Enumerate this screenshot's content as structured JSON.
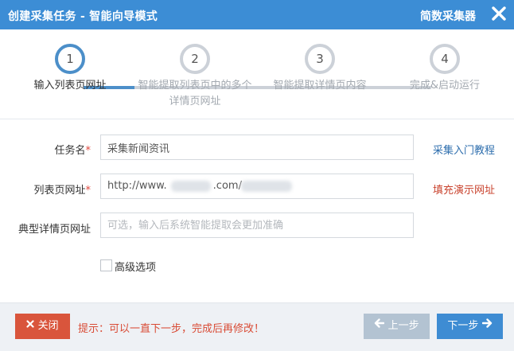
{
  "window": {
    "title": "创建采集任务 - 智能向导模式",
    "brand": "简数采集器",
    "close_icon": "close-icon"
  },
  "steps": [
    {
      "number": "1",
      "label": "输入列表页网址",
      "active": true
    },
    {
      "number": "2",
      "label_line1": "智能提取列表页中的多个",
      "label_line2": "详情页网址",
      "active": false
    },
    {
      "number": "3",
      "label": "智能提取详情页内容",
      "active": false
    },
    {
      "number": "4",
      "label": "完成&启动运行",
      "active": false
    }
  ],
  "form": {
    "task_name": {
      "label": "任务名",
      "required_mark": "*",
      "value": "采集新闻资讯",
      "side_link": "采集入门教程"
    },
    "list_url": {
      "label": "列表页网址",
      "required_mark": "*",
      "value_prefix": "http://www.",
      "value_mid": ".com/",
      "side_link": "填充演示网址"
    },
    "detail_url": {
      "label": "典型详情页网址",
      "placeholder": "可选，输入后系统智能提取会更加准确"
    },
    "advanced": {
      "label": "高级选项",
      "checked": false
    }
  },
  "footer": {
    "close_label": "关闭",
    "tip": "提示：可以一直下一步，完成后再修改！",
    "prev_label": "上一步",
    "next_label": "下一步"
  },
  "colors": {
    "title_bar": "#3c8dd5",
    "step_active": "#4c8fc9",
    "step_inactive": "#ccd1d8",
    "close_button": "#d9553c",
    "prev_button": "#b3c3d2",
    "next_button": "#3e8cd3",
    "tip_text": "#d94b35"
  }
}
